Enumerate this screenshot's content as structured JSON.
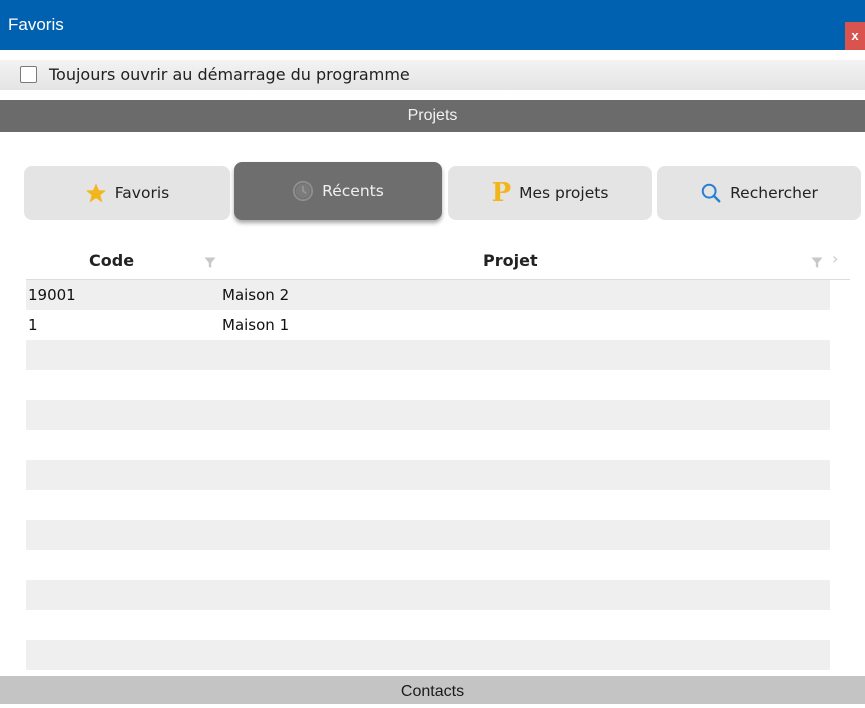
{
  "window": {
    "title": "Favoris",
    "close_label": "x"
  },
  "startup_option": {
    "label": "Toujours ouvrir au démarrage du programme",
    "checked": false
  },
  "sections": {
    "projets": "Projets",
    "contacts": "Contacts"
  },
  "tabs": [
    {
      "label": "Favoris",
      "icon": "star-icon",
      "active": false
    },
    {
      "label": "Récents",
      "icon": "clock-icon",
      "active": true
    },
    {
      "label": "Mes projets",
      "icon": "p-letter-icon",
      "active": false
    },
    {
      "label": "Rechercher",
      "icon": "magnifier-icon",
      "active": false
    }
  ],
  "p_icon_letter": "P",
  "table": {
    "columns": [
      "Code",
      "Projet"
    ],
    "rows": [
      {
        "code": "19001",
        "projet": "Maison 2"
      },
      {
        "code": "1",
        "projet": "Maison 1"
      },
      {
        "code": "",
        "projet": ""
      },
      {
        "code": "",
        "projet": ""
      },
      {
        "code": "",
        "projet": ""
      },
      {
        "code": "",
        "projet": ""
      },
      {
        "code": "",
        "projet": ""
      },
      {
        "code": "",
        "projet": ""
      },
      {
        "code": "",
        "projet": ""
      },
      {
        "code": "",
        "projet": ""
      },
      {
        "code": "",
        "projet": ""
      },
      {
        "code": "",
        "projet": ""
      },
      {
        "code": "",
        "projet": ""
      }
    ]
  },
  "colors": {
    "titlebar": "#0061b0",
    "close": "#d9534f",
    "section": "#6b6b6b",
    "accent_star": "#f3b51c"
  }
}
